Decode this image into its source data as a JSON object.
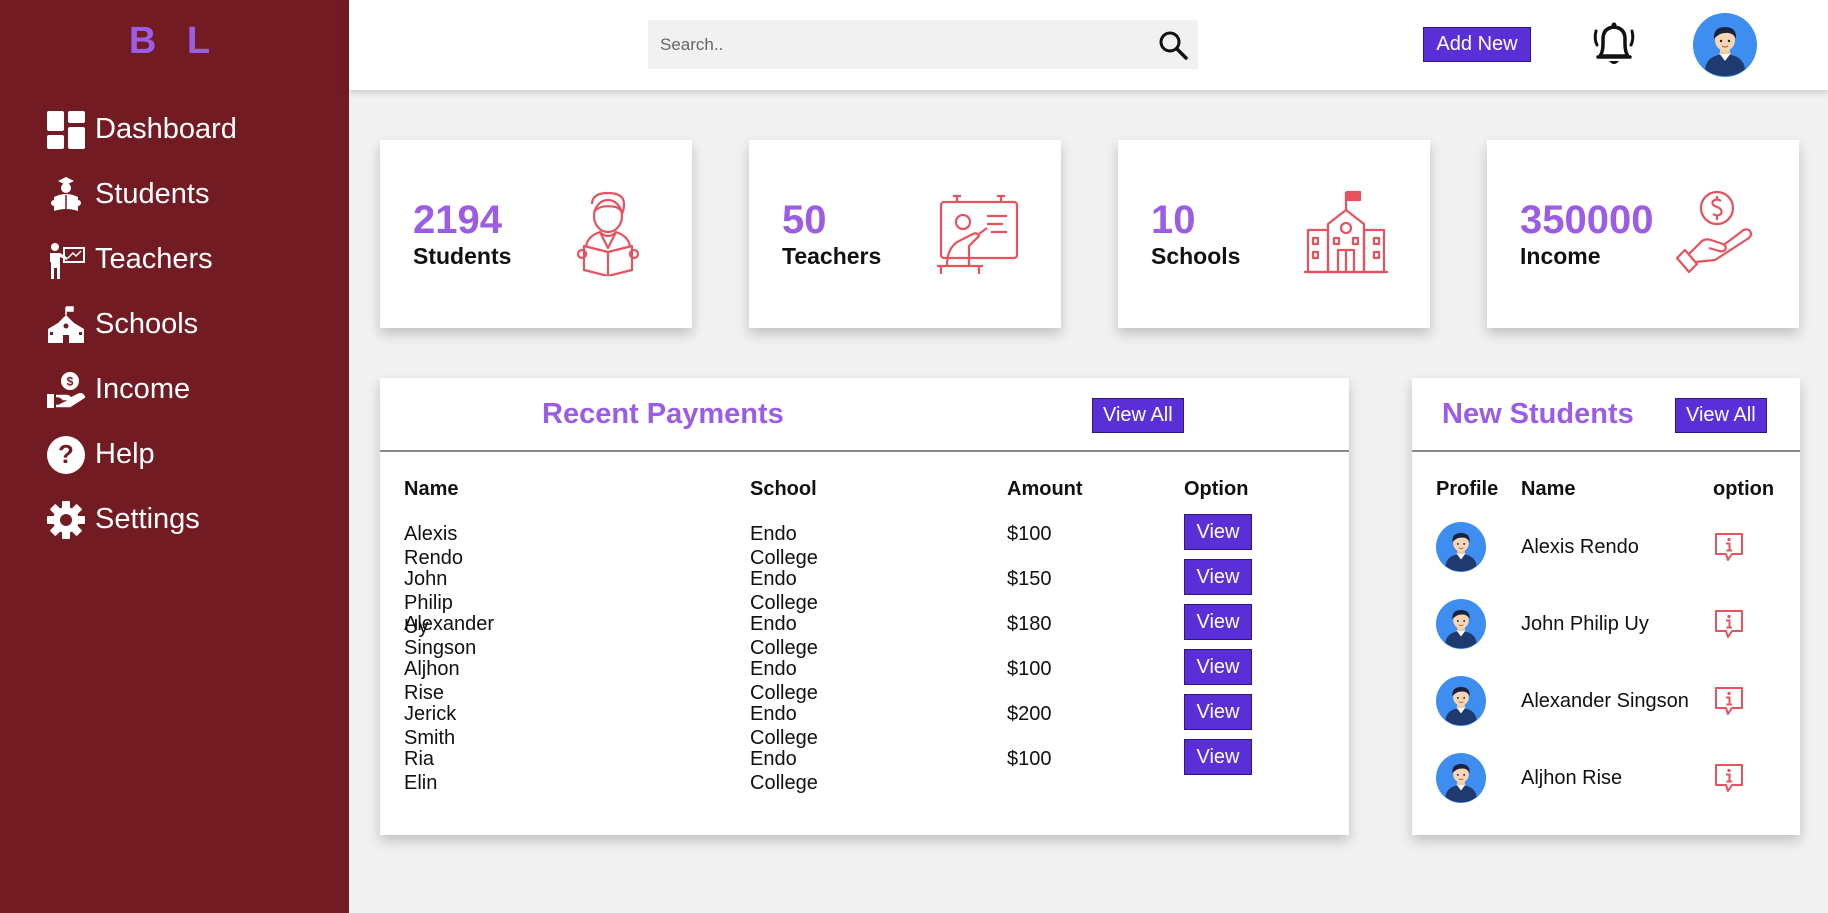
{
  "logo": "B L",
  "colors": {
    "sidebar": "#731b22",
    "accent": "#9b5de5",
    "button": "#5b2fd8",
    "icon": "#e8525f"
  },
  "sidebar": {
    "items": [
      {
        "label": "Dashboard",
        "icon": "dashboard-icon"
      },
      {
        "label": "Students",
        "icon": "student-icon"
      },
      {
        "label": "Teachers",
        "icon": "teacher-icon"
      },
      {
        "label": "Schools",
        "icon": "school-icon"
      },
      {
        "label": "Income",
        "icon": "income-icon"
      },
      {
        "label": "Help",
        "icon": "help-icon"
      },
      {
        "label": "Settings",
        "icon": "settings-icon"
      }
    ]
  },
  "topbar": {
    "search_placeholder": "Search..",
    "search_value": "",
    "add_new_label": "Add New"
  },
  "cards": [
    {
      "number": "2194",
      "label": "Students",
      "icon": "student-reading-icon"
    },
    {
      "number": "50",
      "label": "Teachers",
      "icon": "teacher-board-icon"
    },
    {
      "number": "10",
      "label": "Schools",
      "icon": "school-building-icon"
    },
    {
      "number": "350000",
      "label": "Income",
      "icon": "hand-coin-icon"
    }
  ],
  "recent_payments": {
    "title": "Recent Payments",
    "view_all_label": "View All",
    "columns": [
      "Name",
      "School",
      "Amount",
      "Option"
    ],
    "view_label": "View",
    "rows": [
      {
        "name": "Alexis Rendo",
        "school": "Endo College",
        "amount": "$100"
      },
      {
        "name": "John Philip Uy",
        "school": "Endo College",
        "amount": "$150"
      },
      {
        "name": "Alexander Singson",
        "school": "Endo College",
        "amount": "$180"
      },
      {
        "name": "Aljhon Rise",
        "school": "Endo College",
        "amount": "$100"
      },
      {
        "name": "Jerick Smith",
        "school": "Endo College",
        "amount": "$200"
      },
      {
        "name": "Ria Elin",
        "school": "Endo College",
        "amount": "$100"
      }
    ]
  },
  "new_students": {
    "title": "New Students",
    "view_all_label": "View All",
    "columns": [
      "Profile",
      "Name",
      "option"
    ],
    "rows": [
      {
        "name": "Alexis Rendo"
      },
      {
        "name": "John Philip Uy"
      },
      {
        "name": "Alexander Singson"
      },
      {
        "name": "Aljhon Rise"
      }
    ]
  }
}
